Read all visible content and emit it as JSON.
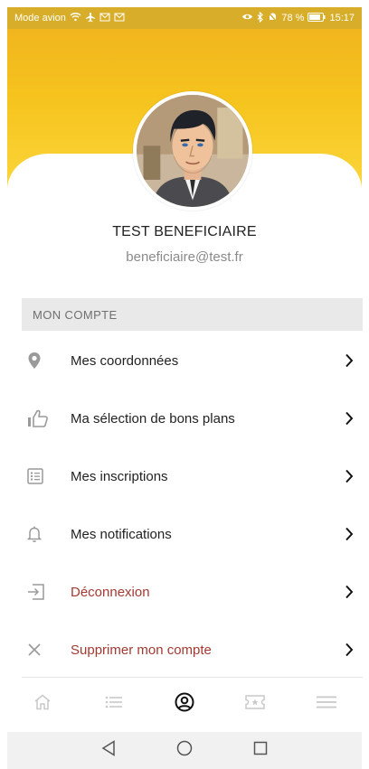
{
  "status_bar": {
    "left_text": "Mode avion",
    "battery": "78 %",
    "time": "15:17"
  },
  "profile": {
    "name": "TEST BENEFICIAIRE",
    "email": "beneficiaire@test.fr"
  },
  "section": {
    "title": "MON COMPTE"
  },
  "menu": [
    {
      "label": "Mes coordonnées",
      "icon": "location-pin-icon"
    },
    {
      "label": "Ma sélection de bons plans",
      "icon": "thumbs-up-icon"
    },
    {
      "label": "Mes inscriptions",
      "icon": "list-document-icon"
    },
    {
      "label": "Mes notifications",
      "icon": "bell-icon"
    },
    {
      "label": "Déconnexion",
      "icon": "logout-icon"
    },
    {
      "label": "Supprimer mon compte",
      "icon": "close-icon"
    }
  ],
  "tabs": [
    {
      "icon": "home-icon",
      "active": false
    },
    {
      "icon": "list-icon",
      "active": false
    },
    {
      "icon": "user-circle-icon",
      "active": true
    },
    {
      "icon": "ticket-icon",
      "active": false
    },
    {
      "icon": "hamburger-menu-icon",
      "active": false
    }
  ],
  "colors": {
    "header_gradient_top": "#f1b61e",
    "header_gradient_bottom": "#fbd63b",
    "danger_text": "#a23a32",
    "section_bg": "#e9e9e9"
  }
}
